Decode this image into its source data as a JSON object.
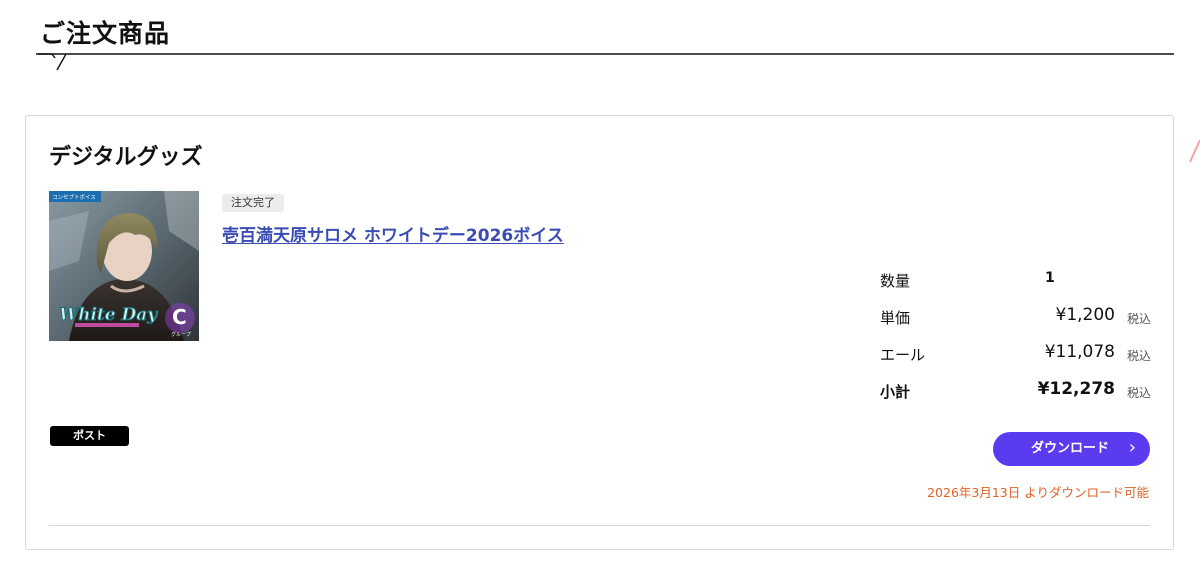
{
  "page": {
    "heading": "ご注文商品"
  },
  "card": {
    "title": "デジタルグッズ",
    "thumbnail": {
      "tag": "コンセプトボイス",
      "logo_text": "White Day",
      "group_letter": "C",
      "group_label": "グループ"
    },
    "status": "注文完了",
    "product_name": "壱百満天原サロメ ホワイトデー2026ボイス",
    "summary": {
      "quantity_label": "数量",
      "quantity_value": "1",
      "unit_price_label": "単価",
      "unit_price_value": "¥1,200",
      "yell_label": "エール",
      "yell_value": "¥11,078",
      "subtotal_label": "小計",
      "subtotal_value": "¥12,278",
      "tax_label": "税込"
    },
    "post_label": "ポスト",
    "download_label": "ダウンロード",
    "download_note": "2026年3月13日 よりダウンロード可能"
  },
  "colors": {
    "accent_button": "#5a3bf0",
    "note_orange": "#e1632a",
    "link_blue": "#3a4cb4"
  },
  "icons": {
    "download_chevron": "chevron-right-icon"
  }
}
